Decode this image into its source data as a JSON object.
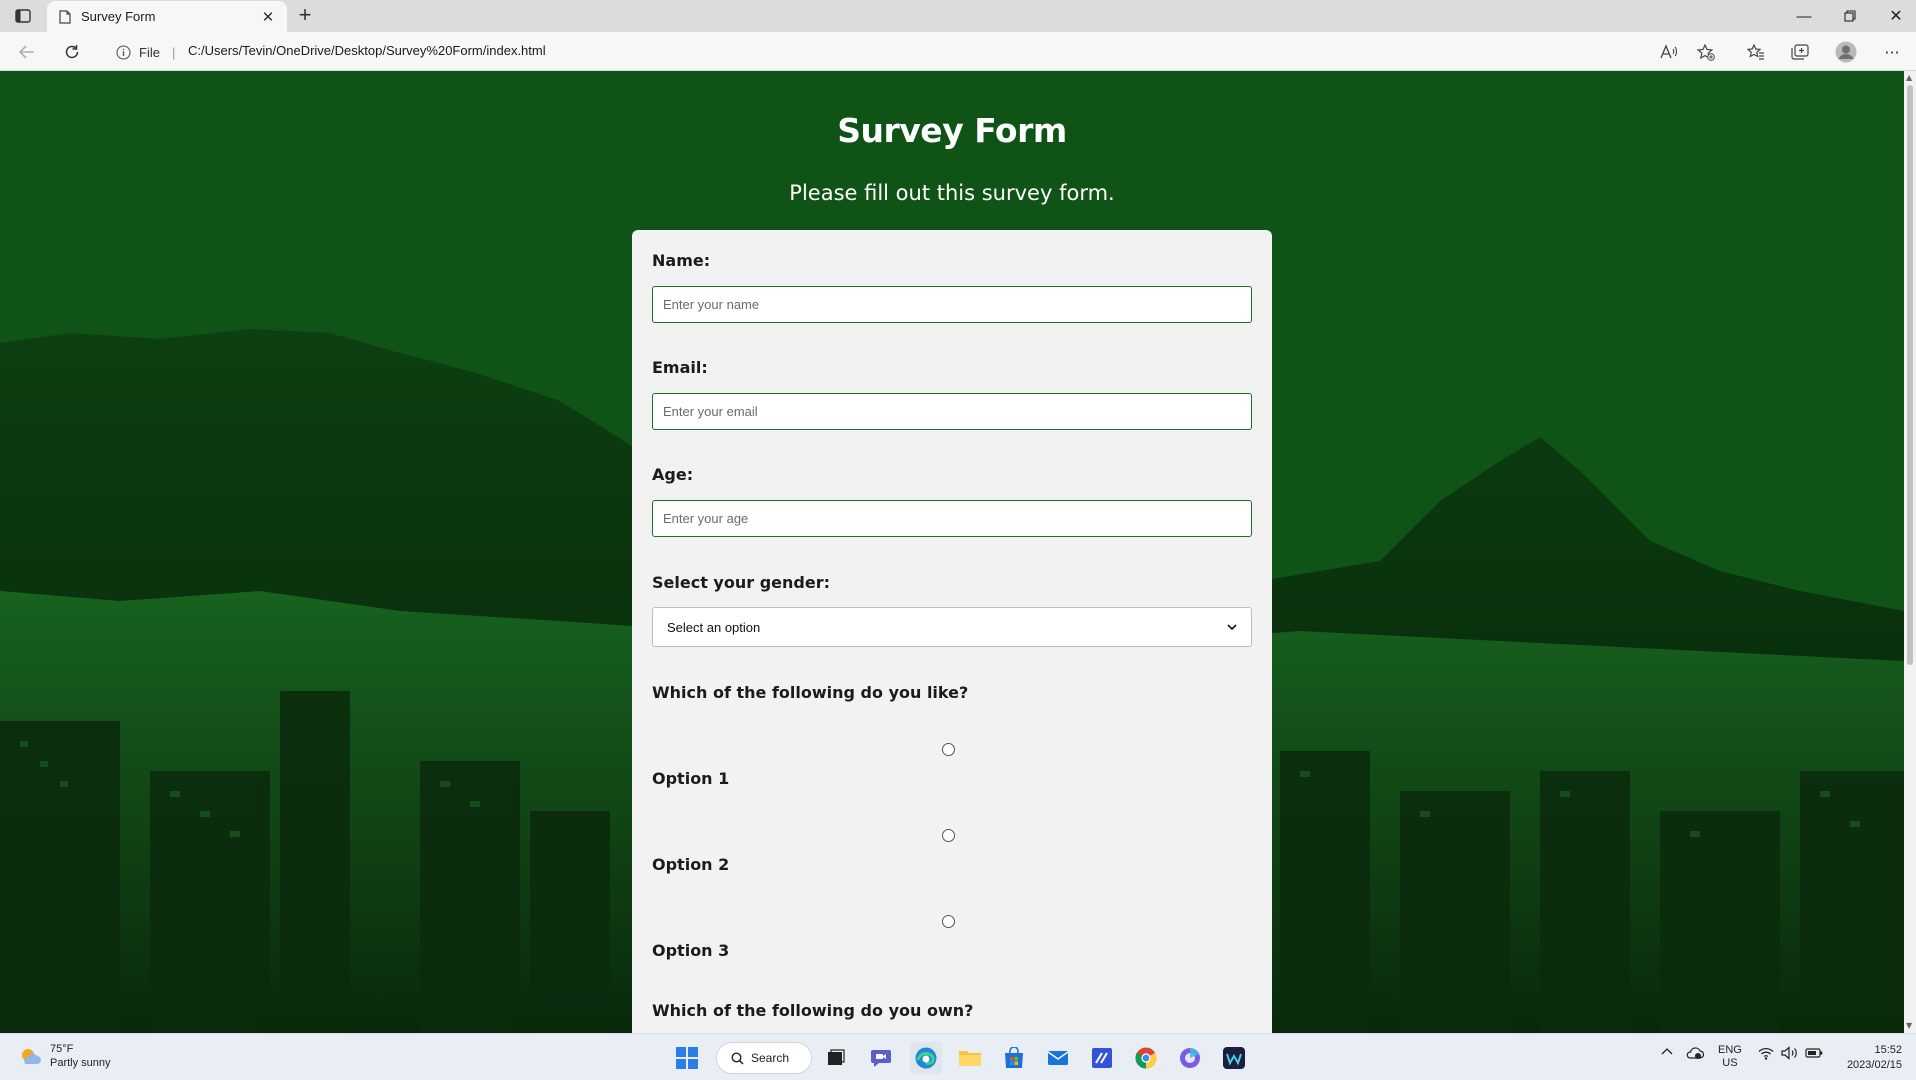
{
  "browser": {
    "tab_title": "Survey Form",
    "url_scheme": "File",
    "url": "C:/Users/Tevin/OneDrive/Desktop/Survey%20Form/index.html"
  },
  "page": {
    "title": "Survey Form",
    "description": "Please fill out this survey form.",
    "form": {
      "name_label": "Name:",
      "name_placeholder": "Enter your name",
      "email_label": "Email:",
      "email_placeholder": "Enter your email",
      "age_label": "Age:",
      "age_placeholder": "Enter your age",
      "gender_label": "Select your gender:",
      "gender_selected": "Select an option",
      "likes_label": "Which of the following do you like?",
      "options": [
        {
          "label": "Option 1"
        },
        {
          "label": "Option 2"
        },
        {
          "label": "Option 3"
        }
      ],
      "owns_label": "Which of the following do you own?"
    }
  },
  "taskbar": {
    "weather_temp": "75°F",
    "weather_desc": "Partly sunny",
    "search_label": "Search",
    "lang_top": "ENG",
    "lang_bottom": "US",
    "time": "15:52",
    "date": "2023/02/15"
  },
  "colors": {
    "page_background": "#0f5316",
    "form_background": "#f2f2f2",
    "input_border": "#1f6e2a"
  }
}
